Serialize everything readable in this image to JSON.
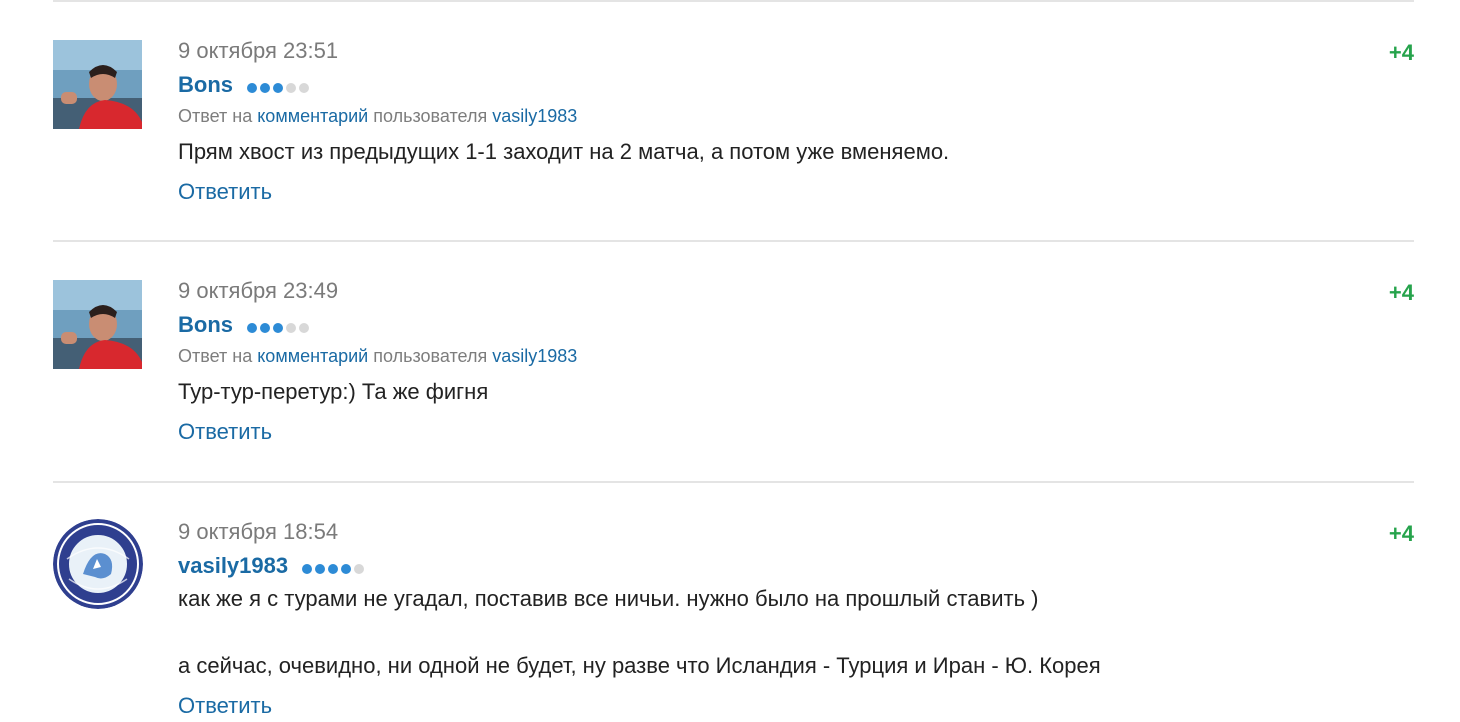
{
  "comments": [
    {
      "date": "9 октября 23:51",
      "author": "Bons",
      "rating_level": 3,
      "rating_max": 5,
      "reply_prefix": "Ответ на",
      "reply_link": "комментарий",
      "reply_middle": "пользователя",
      "reply_user": "vasily1983",
      "text": "Прям хвост из предыдущих 1-1 заходит на 2 матча, а потом уже вменяемо.",
      "reply_label": "Ответить",
      "score": "+4"
    },
    {
      "date": "9 октября 23:49",
      "author": "Bons",
      "rating_level": 3,
      "rating_max": 5,
      "reply_prefix": "Ответ на",
      "reply_link": "комментарий",
      "reply_middle": "пользователя",
      "reply_user": "vasily1983",
      "text": "Тур-тур-перетур:) Та же фигня",
      "reply_label": "Ответить",
      "score": "+4"
    },
    {
      "date": "9 октября 18:54",
      "author": "vasily1983",
      "rating_level": 4,
      "rating_max": 5,
      "text_line1": "как же я с турами не угадал, поставив все ничьи. нужно было на прошлый ставить )",
      "text_line2": "а сейчас, очевидно, ни одной не будет, ну разве что Исландия - Турция и Иран - Ю. Корея",
      "reply_label": "Ответить",
      "score": "+4"
    }
  ],
  "colors": {
    "link": "#1a6aa4",
    "score": "#26a34c",
    "meta": "#7a7a7a",
    "dot_on": "#2d8bd6",
    "dot_off": "#d8d8d8"
  }
}
